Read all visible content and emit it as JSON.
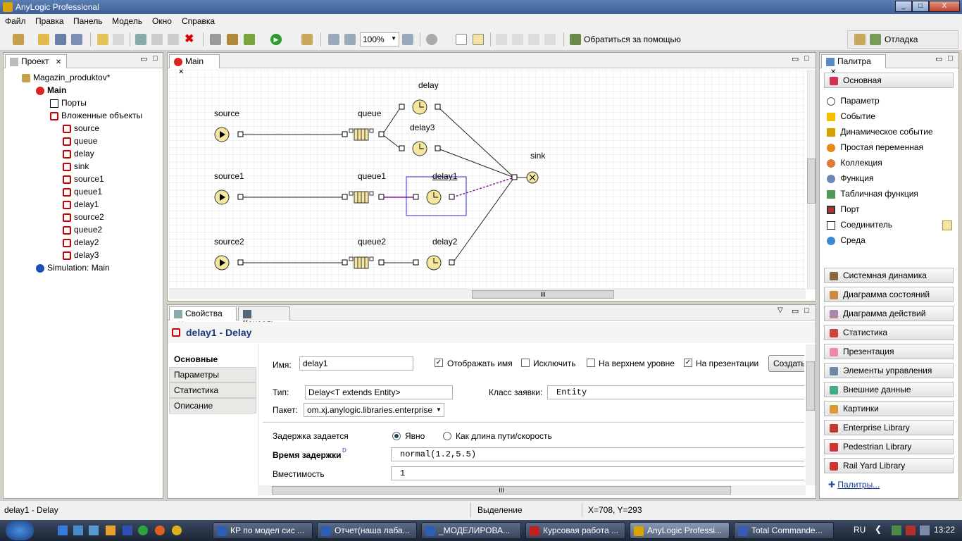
{
  "window": {
    "title": "AnyLogic Professional",
    "min": "_",
    "max": "□",
    "close": "X"
  },
  "menu": [
    "Файл",
    "Правка",
    "Панель",
    "Модель",
    "Окно",
    "Справка"
  ],
  "toolbar": {
    "zoom": "100%",
    "help_label": "Обратиться за помощью",
    "perspective": "Отладка"
  },
  "project": {
    "tab_label": "Проект",
    "root": "Magazin_produktov*",
    "main": "Main",
    "ports": "Порты",
    "embedded": "Вложенные объекты",
    "items": [
      "source",
      "queue",
      "delay",
      "sink",
      "source1",
      "queue1",
      "delay1",
      "source2",
      "queue2",
      "delay2",
      "delay3"
    ],
    "simulation": "Simulation: Main"
  },
  "editor": {
    "tab_label": "Main",
    "nodes": {
      "source": "source",
      "queue": "queue",
      "delay": "delay",
      "delay3": "delay3",
      "sink": "sink",
      "source1": "source1",
      "queue1": "queue1",
      "delay1": "delay1",
      "source2": "source2",
      "queue2": "queue2",
      "delay2": "delay2"
    },
    "scroll_grip": "III"
  },
  "palette": {
    "tab_label": "Палитра",
    "basic_label": "Основная",
    "items": [
      "Параметр",
      "Событие",
      "Динамическое событие",
      "Простая переменная",
      "Коллекция",
      "Функция",
      "Табличная функция",
      "Порт",
      "Соединитель",
      "Среда"
    ],
    "groups": [
      "Системная динамика",
      "Диаграмма состояний",
      "Диаграмма действий",
      "Статистика",
      "Презентация",
      "Элементы управления",
      "Внешние данные",
      "Картинки",
      "Enterprise Library",
      "Pedestrian Library",
      "Rail Yard Library"
    ],
    "more_label": "Палитры..."
  },
  "properties": {
    "tab_props": "Свойства",
    "tab_console": "Консоль",
    "title": "delay1 - Delay",
    "side_tabs": [
      "Основные",
      "Параметры",
      "Статистика",
      "Описание"
    ],
    "name_label": "Имя:",
    "name_value": "delay1",
    "show_name": "Отображать имя",
    "exclude": "Исключить",
    "top_level": "На верхнем уровне",
    "on_presentation": "На презентации",
    "create_btn": "Создать",
    "type_label": "Тип:",
    "type_value": "Delay<T extends Entity>",
    "package_label": "Пакет:",
    "package_value": "om.xj.anylogic.libraries.enterprise",
    "entity_class_label": "Класс заявки:",
    "entity_class_value": "Entity",
    "delay_set_label": "Задержка задается",
    "radio_explicit": "Явно",
    "radio_path": "Как длина пути/скорость",
    "delay_time_label": "Время задержки",
    "delay_time_sup": "D",
    "delay_time_value": "normal(1.2,5.5)",
    "capacity_label": "Вместимость",
    "capacity_value": "1"
  },
  "status": {
    "left": "delay1 - Delay",
    "mode": "Выделение",
    "coords": "X=708, Y=293"
  },
  "taskbar": {
    "tasks": [
      "КР по модел сис ...",
      "Отчет(наша лаба...",
      "_МОДЕЛИРОВА...",
      "Курсовая работа ...",
      "AnyLogic Professi...",
      "Total Commande..."
    ],
    "lang": "RU",
    "time": "13:22"
  }
}
